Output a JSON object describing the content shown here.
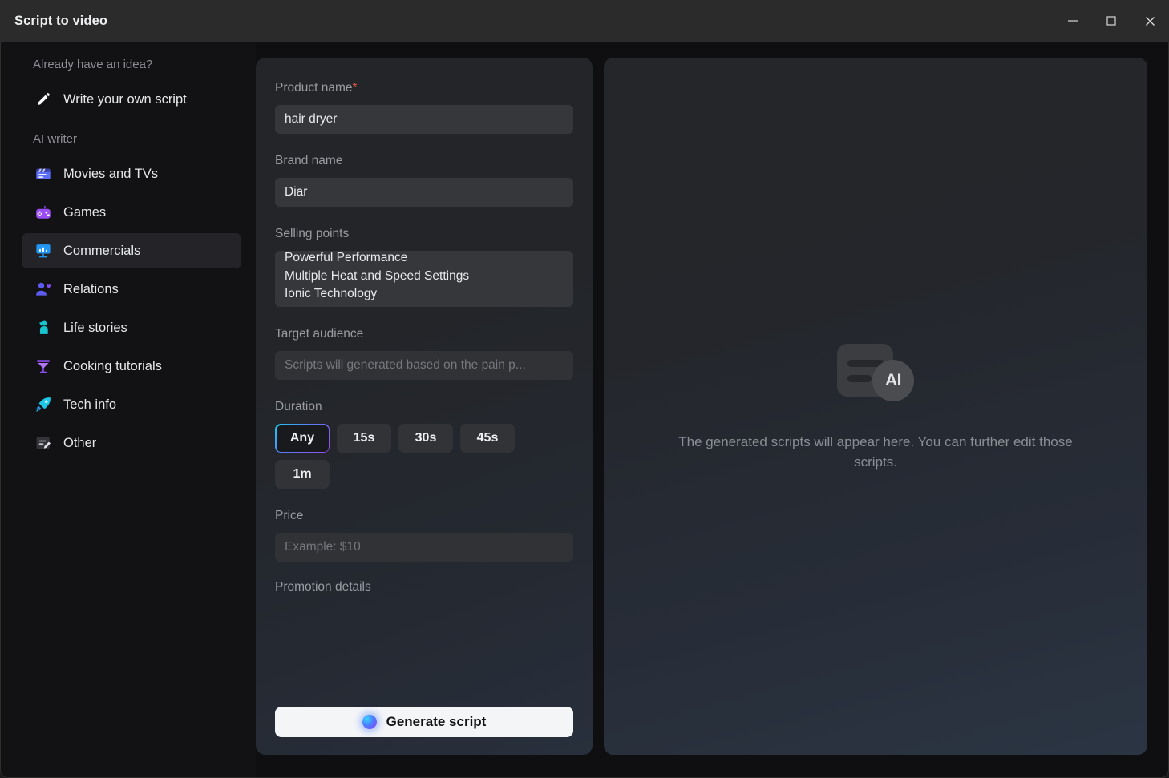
{
  "window": {
    "title": "Script to video",
    "controls": [
      {
        "name": "minimize-button",
        "glyph": "minimize"
      },
      {
        "name": "maximize-button",
        "glyph": "maximize"
      },
      {
        "name": "close-button",
        "glyph": "close"
      }
    ]
  },
  "sidebar": {
    "section_one_label": "Already have an idea?",
    "section_two_label": "AI writer",
    "write_own": {
      "label": "Write your own script",
      "icon": "pencil-icon"
    },
    "items": [
      {
        "label": "Movies and TVs",
        "icon": "clapperboard-icon",
        "selected": false
      },
      {
        "label": "Games",
        "icon": "gamepad-icon",
        "selected": false
      },
      {
        "label": "Commercials",
        "icon": "presentation-chart-icon",
        "selected": true
      },
      {
        "label": "Relations",
        "icon": "person-heart-icon",
        "selected": false
      },
      {
        "label": "Life stories",
        "icon": "person-waving-icon",
        "selected": false
      },
      {
        "label": "Cooking tutorials",
        "icon": "cocktail-glass-icon",
        "selected": false
      },
      {
        "label": "Tech info",
        "icon": "rocket-icon",
        "selected": false
      },
      {
        "label": "Other",
        "icon": "note-edit-icon",
        "selected": false
      }
    ]
  },
  "form": {
    "product_name": {
      "label": "Product name",
      "required_mark": "*",
      "value": "hair dryer"
    },
    "brand_name": {
      "label": "Brand name",
      "value": "Diar"
    },
    "selling_points": {
      "label": "Selling points",
      "lines": [
        "Powerful Performance",
        "Multiple Heat and Speed Settings",
        "Ionic Technology"
      ]
    },
    "target_audience": {
      "label": "Target audience",
      "value": "",
      "placeholder": "Scripts will generated based on the pain p..."
    },
    "duration": {
      "label": "Duration",
      "options": [
        "Any",
        "15s",
        "30s",
        "45s",
        "1m"
      ],
      "selected": "Any"
    },
    "price": {
      "label": "Price",
      "value": "",
      "placeholder": "Example: $10"
    },
    "promotion_details": {
      "label": "Promotion details"
    },
    "generate_button": {
      "label": "Generate script",
      "icon": "ai-orb-icon"
    }
  },
  "preview": {
    "icon": "ai-script-placeholder-icon",
    "badge_text": "AI",
    "empty_text": "The generated scripts will appear here. You can further edit those scripts."
  },
  "colors": {
    "accent_blue": "#22c9f0",
    "accent_purple": "#9b4df0",
    "required_red": "#e4564a",
    "selected_item_bg": "#242428"
  }
}
